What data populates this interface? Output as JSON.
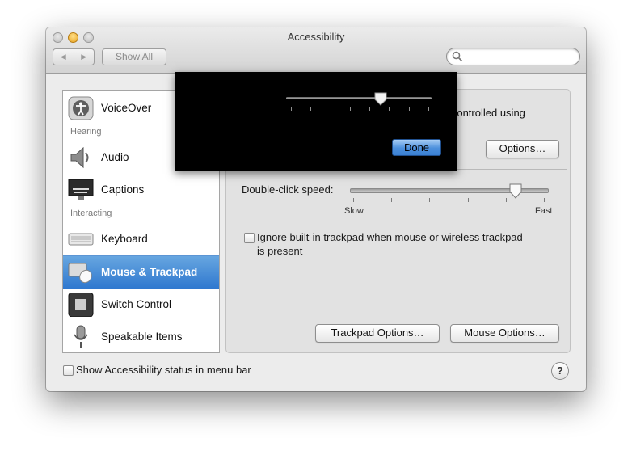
{
  "window": {
    "title": "Accessibility"
  },
  "toolbar": {
    "back_icon": "back-arrow-icon",
    "forward_icon": "forward-arrow-icon",
    "show_all_label": "Show All",
    "search_placeholder": ""
  },
  "sidebar": {
    "items": [
      {
        "label": "VoiceOver",
        "icon": "voiceover-icon"
      },
      {
        "label": "Audio",
        "icon": "speaker-icon"
      },
      {
        "label": "Captions",
        "icon": "captions-icon"
      },
      {
        "label": "Keyboard",
        "icon": "keyboard-icon"
      },
      {
        "label": "Mouse & Trackpad",
        "icon": "mouse-trackpad-icon",
        "selected": true
      },
      {
        "label": "Switch Control",
        "icon": "switch-control-icon"
      },
      {
        "label": "Speakable Items",
        "icon": "microphone-icon"
      }
    ],
    "headers": {
      "hearing": "Hearing",
      "interacting": "Interacting"
    }
  },
  "panel": {
    "partial_text": "e controlled using",
    "options_button": "Options…",
    "double_click_label": "Double-click speed:",
    "slow_label": "Slow",
    "fast_label": "Fast",
    "double_click_speed_fraction": 0.85,
    "ignore_trackpad_label_line1": "Ignore built-in trackpad when mouse or wireless trackpad",
    "ignore_trackpad_label_line2": "is present",
    "ignore_trackpad_checked": false,
    "trackpad_options_button": "Trackpad Options…",
    "mouse_options_button": "Mouse Options…"
  },
  "footer": {
    "status_menu_label": "Show Accessibility status in menu bar",
    "status_menu_checked": false,
    "help_label": "?"
  },
  "overlay": {
    "slider_fraction": 0.65,
    "done_label": "Done"
  },
  "colors": {
    "selection": "#3a80d2",
    "done_button": "#4b8fdc"
  }
}
